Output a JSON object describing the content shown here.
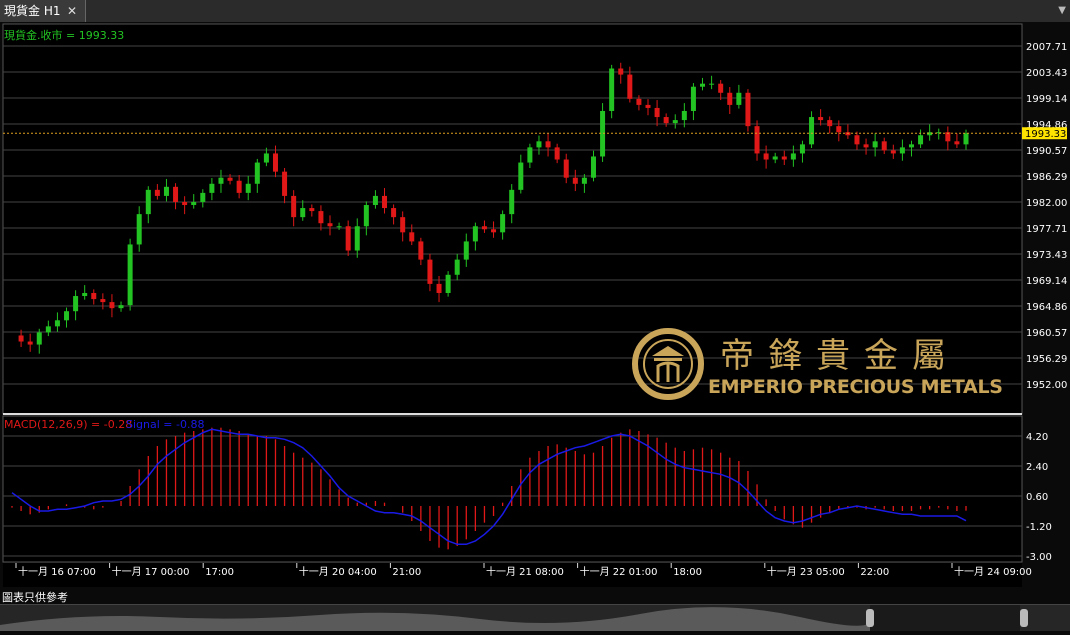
{
  "tab": {
    "title": "現貨金 H1",
    "close": "✕",
    "menu": "▼"
  },
  "price_label": "現貨金.收市 = 1993.33",
  "current_price": "1993.33",
  "price_axis": [
    "2007.71",
    "2003.43",
    "1999.14",
    "1994.86",
    "1990.57",
    "1986.29",
    "1982.00",
    "1977.71",
    "1973.43",
    "1969.14",
    "1964.86",
    "1960.57",
    "1956.29",
    "1952.00"
  ],
  "macd": {
    "label": "MACD(12,26,9) = -0.28",
    "signal_label": "Signal = -0.88",
    "axis": [
      "4.20",
      "2.40",
      "0.60",
      "-1.20",
      "-3.00"
    ]
  },
  "time_axis": [
    "十一月 16 07:00",
    "十一月 17 00:00",
    "17:00",
    "十一月 20 04:00",
    "21:00",
    "十一月 21 08:00",
    "十一月 22 01:00",
    "18:00",
    "十一月 23 05:00",
    "22:00",
    "十一月 24 09:00"
  ],
  "disclaimer": "圖表只供參考",
  "logo": {
    "chinese": "帝鋒貴金屬",
    "english": "EMPERIO PRECIOUS METALS"
  },
  "colors": {
    "up": "#22c322",
    "down": "#e01818",
    "signal": "#1a1ae6",
    "price_line": "#e0a020",
    "label_green": "#22c322",
    "logo_gold": "#c9a55a"
  },
  "chart_data": [
    {
      "type": "candlestick",
      "title": "現貨金 H1",
      "ylim": [
        1952.0,
        2009.5
      ],
      "x": [
        "十一月 16 07:00",
        "十一月 17 00:00",
        "17:00",
        "十一月 20 04:00",
        "21:00",
        "十一月 21 08:00",
        "十一月 22 01:00",
        "18:00",
        "十一月 23 05:00",
        "22:00",
        "十一月 24 09:00"
      ],
      "close_path": [
        1960.0,
        1959.0,
        1958.5,
        1960.5,
        1961.5,
        1962.5,
        1964.0,
        1966.5,
        1967.0,
        1966.0,
        1965.5,
        1964.5,
        1965.0,
        1975.0,
        1980.0,
        1984.0,
        1983.0,
        1984.5,
        1982.0,
        1981.5,
        1982.0,
        1983.5,
        1985.0,
        1986.0,
        1985.5,
        1983.5,
        1985.0,
        1988.5,
        1990.0,
        1987.0,
        1983.0,
        1979.5,
        1981.0,
        1980.5,
        1978.5,
        1978.0,
        1978.0,
        1974.0,
        1978.0,
        1981.5,
        1983.0,
        1981.0,
        1979.5,
        1977.0,
        1975.5,
        1972.5,
        1968.5,
        1967.0,
        1970.0,
        1972.5,
        1975.5,
        1978.0,
        1977.5,
        1977.0,
        1980.0,
        1984.0,
        1988.5,
        1991.0,
        1992.0,
        1991.0,
        1989.0,
        1986.0,
        1985.0,
        1986.0,
        1989.5,
        1997.0,
        2004.0,
        2003.0,
        1999.0,
        1998.0,
        1997.5,
        1996.0,
        1995.0,
        1995.5,
        1997.0,
        2001.0,
        2001.5,
        2001.5,
        2000.0,
        1998.0,
        2000.0,
        1994.5,
        1990.0,
        1989.0,
        1989.5,
        1989.0,
        1990.0,
        1991.5,
        1996.0,
        1995.5,
        1994.5,
        1993.5,
        1993.0,
        1991.5,
        1991.0,
        1992.0,
        1990.5,
        1990.0,
        1991.0,
        1991.5,
        1993.0,
        1993.5,
        1993.5,
        1992.0,
        1991.5,
        1993.33
      ],
      "current": 1993.33
    },
    {
      "type": "bar",
      "title": "MACD(12,26,9) = -0.28",
      "ylim": [
        -3.5,
        5.0
      ],
      "ticks": [
        4.2,
        2.4,
        0.6,
        -1.2,
        -3.0
      ],
      "series": [
        {
          "name": "MACD(12,26,9)",
          "values": [
            -0.1,
            -0.3,
            -0.5,
            -0.4,
            -0.2,
            0.0,
            0.1,
            0.0,
            -0.1,
            -0.2,
            -0.1,
            0.0,
            0.3,
            1.2,
            2.2,
            3.0,
            3.6,
            4.0,
            4.2,
            4.4,
            4.5,
            4.6,
            4.7,
            4.7,
            4.6,
            4.5,
            4.3,
            4.2,
            4.2,
            4.0,
            3.6,
            3.2,
            2.9,
            2.6,
            2.2,
            1.6,
            1.0,
            0.5,
            0.2,
            0.2,
            0.3,
            0.2,
            0.0,
            -0.4,
            -0.9,
            -1.5,
            -2.1,
            -2.5,
            -2.6,
            -2.4,
            -2.0,
            -1.5,
            -1.0,
            -0.6,
            0.2,
            1.2,
            2.2,
            2.9,
            3.3,
            3.6,
            3.7,
            3.5,
            3.3,
            3.1,
            3.2,
            3.6,
            4.1,
            4.4,
            4.6,
            4.5,
            4.3,
            4.1,
            3.8,
            3.5,
            3.3,
            3.4,
            3.5,
            3.4,
            3.2,
            2.9,
            2.7,
            2.1,
            1.3,
            0.4,
            -0.3,
            -0.8,
            -1.1,
            -1.3,
            -1.0,
            -0.7,
            -0.4,
            -0.2,
            -0.1,
            -0.1,
            -0.2,
            -0.1,
            -0.2,
            -0.3,
            -0.3,
            -0.3,
            -0.2,
            -0.2,
            -0.1,
            -0.2,
            -0.3,
            -0.28
          ]
        },
        {
          "name": "Signal",
          "values": [
            0.8,
            0.4,
            0.0,
            -0.3,
            -0.3,
            -0.2,
            -0.2,
            -0.1,
            0.0,
            0.2,
            0.3,
            0.3,
            0.4,
            0.7,
            1.2,
            1.8,
            2.5,
            3.0,
            3.4,
            3.8,
            4.1,
            4.4,
            4.6,
            4.5,
            4.4,
            4.3,
            4.3,
            4.2,
            4.1,
            4.1,
            4.0,
            3.8,
            3.5,
            3.0,
            2.4,
            1.8,
            1.1,
            0.6,
            0.3,
            0.0,
            -0.3,
            -0.4,
            -0.4,
            -0.5,
            -0.6,
            -0.9,
            -1.3,
            -1.7,
            -2.1,
            -2.3,
            -2.3,
            -2.1,
            -1.7,
            -1.2,
            -0.5,
            0.4,
            1.3,
            2.0,
            2.5,
            2.8,
            3.1,
            3.3,
            3.5,
            3.6,
            3.8,
            4.0,
            4.2,
            4.3,
            4.2,
            3.9,
            3.6,
            3.2,
            2.8,
            2.5,
            2.3,
            2.2,
            2.1,
            2.0,
            1.9,
            1.7,
            1.4,
            0.9,
            0.3,
            -0.3,
            -0.7,
            -0.9,
            -1.0,
            -0.9,
            -0.7,
            -0.5,
            -0.4,
            -0.2,
            -0.1,
            0.0,
            -0.1,
            -0.2,
            -0.3,
            -0.4,
            -0.5,
            -0.5,
            -0.6,
            -0.6,
            -0.6,
            -0.6,
            -0.6,
            -0.88
          ]
        }
      ]
    }
  ]
}
